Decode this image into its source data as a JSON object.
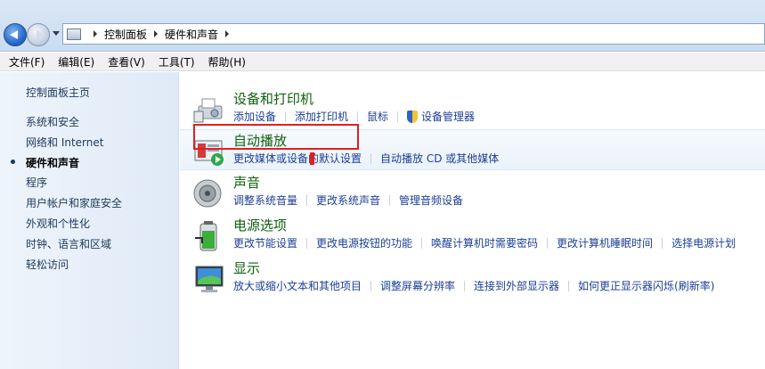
{
  "address": {
    "crumbs": [
      "控制面板",
      "硬件和声音"
    ]
  },
  "menu": [
    "文件(F)",
    "编辑(E)",
    "查看(V)",
    "工具(T)",
    "帮助(H)"
  ],
  "sidebar": {
    "home": "控制面板主页",
    "items": [
      {
        "label": "系统和安全"
      },
      {
        "label": "网络和 Internet"
      },
      {
        "label": "硬件和声音"
      },
      {
        "label": "程序"
      },
      {
        "label": "用户帐户和家庭安全"
      },
      {
        "label": "外观和个性化"
      },
      {
        "label": "时钟、语言和区域"
      },
      {
        "label": "轻松访问"
      }
    ]
  },
  "categories": [
    {
      "title": "设备和打印机",
      "icon": "printer-icon",
      "links": [
        "添加设备",
        "添加打印机",
        "鼠标",
        "设备管理器"
      ]
    },
    {
      "title": "自动播放",
      "icon": "autoplay-icon",
      "links": [
        "更改媒体或设备的默认设置",
        "自动播放 CD 或其他媒体"
      ]
    },
    {
      "title": "声音",
      "icon": "speaker-icon",
      "links": [
        "调整系统音量",
        "更改系统声音",
        "管理音频设备"
      ]
    },
    {
      "title": "电源选项",
      "icon": "battery-icon",
      "links": [
        "更改节能设置",
        "更改电源按钮的功能",
        "唤醒计算机时需要密码",
        "更改计算机睡眠时间",
        "选择电源计划"
      ]
    },
    {
      "title": "显示",
      "icon": "monitor-icon",
      "links": [
        "放大或缩小文本和其他项目",
        "调整屏幕分辨率",
        "连接到外部显示器",
        "如何更正显示器闪烁(刷新率)"
      ]
    }
  ],
  "colors": {
    "title": "#11600f",
    "link": "#1c3f94",
    "highlight": "#e02020"
  }
}
